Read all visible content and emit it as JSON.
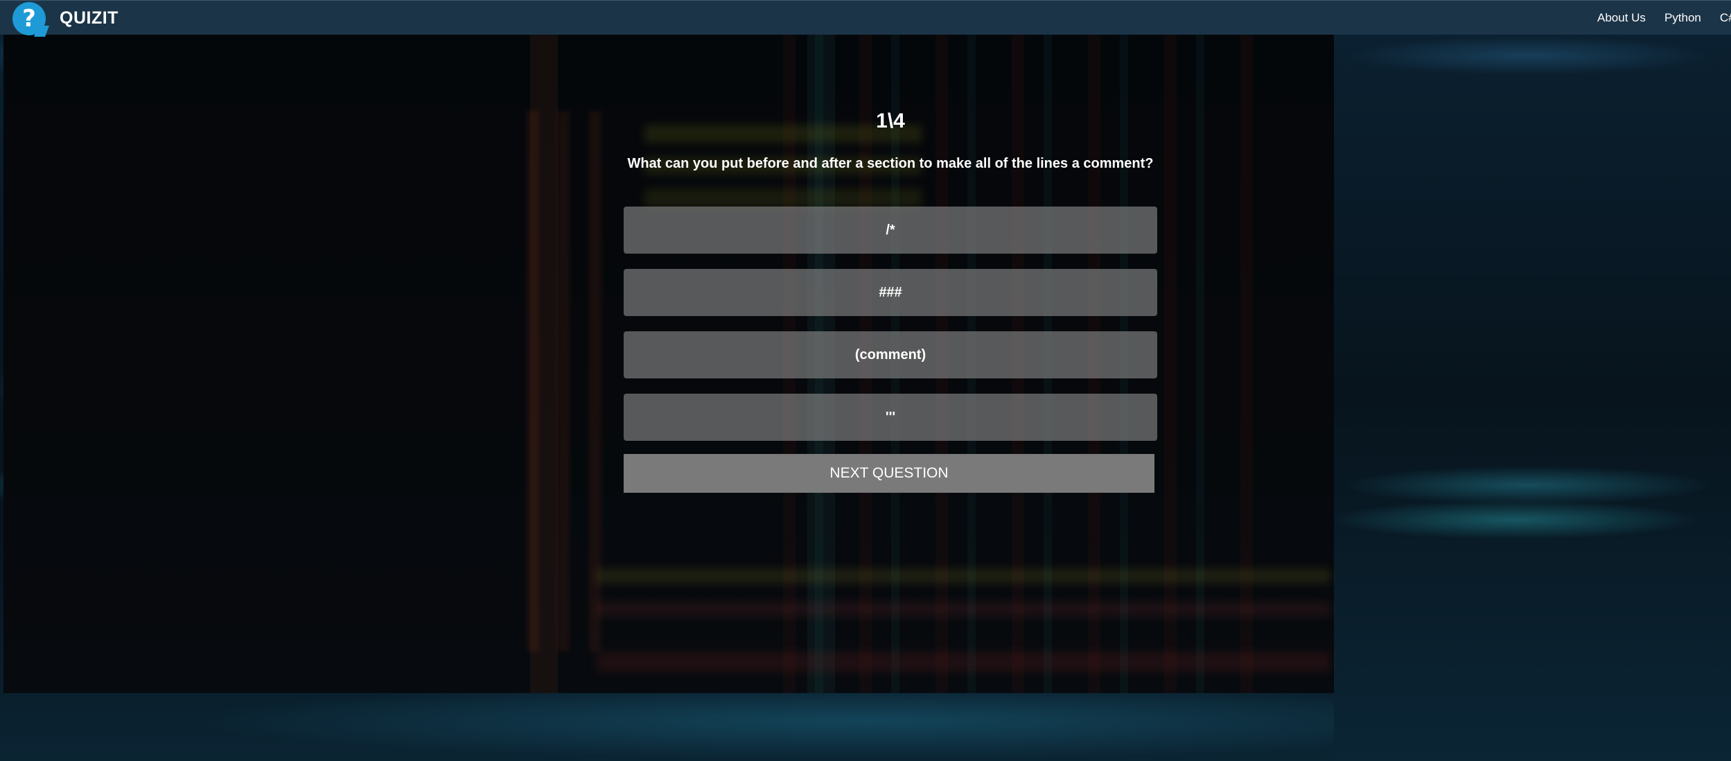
{
  "app": {
    "logo_text": "QUIZIT",
    "logo_glyph": "?"
  },
  "nav": {
    "links": [
      {
        "label": "About Us"
      },
      {
        "label": "Python"
      },
      {
        "label": "C#"
      }
    ]
  },
  "quiz": {
    "progress": "1\\4",
    "question": "What can you put before and after a section to make all of the lines a comment?",
    "answers": [
      {
        "label": "/*"
      },
      {
        "label": "###"
      },
      {
        "label": "(comment)"
      },
      {
        "label": "'''"
      }
    ],
    "next_label": "NEXT QUESTION"
  },
  "colors": {
    "navbar": "#1c3448",
    "logo_accent": "#1e9bd6",
    "answer_bg": "#808080",
    "button_bg": "#7a7a7a"
  },
  "icons": {
    "logo": "question-mark-bubble-icon"
  }
}
